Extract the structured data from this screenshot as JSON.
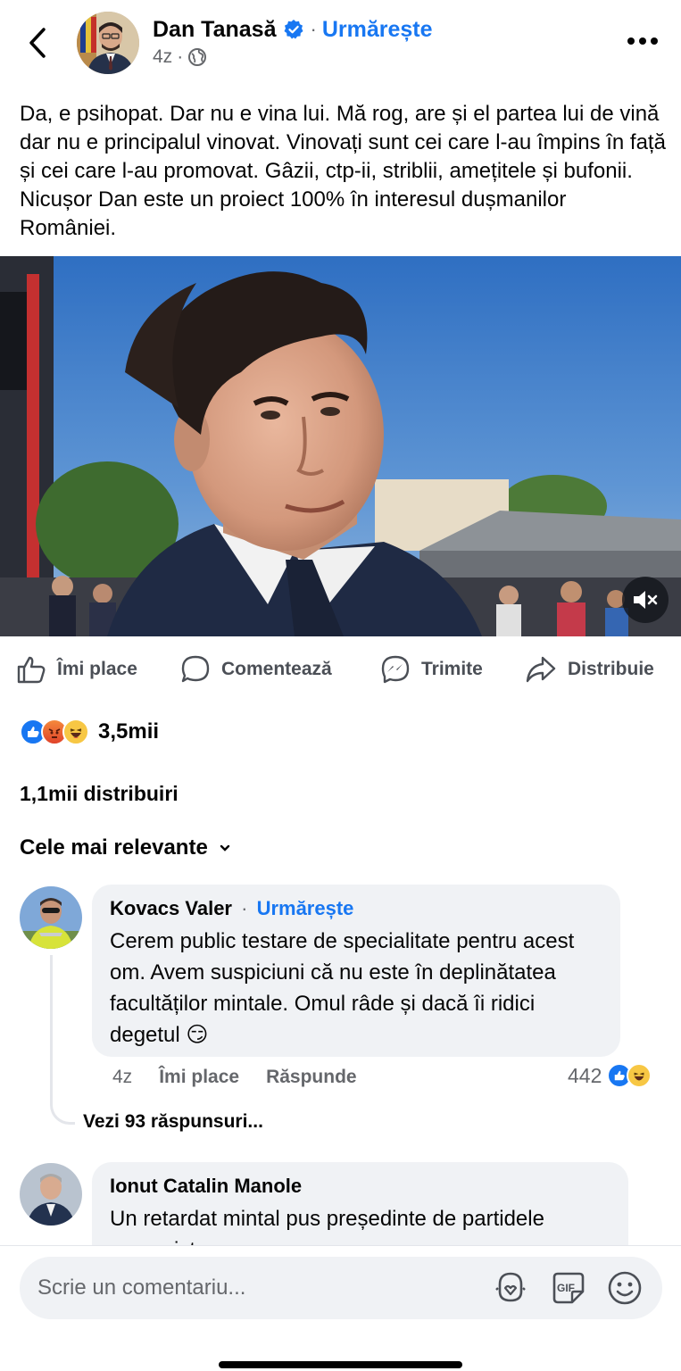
{
  "post": {
    "author": "Dan Tanasă",
    "follow_label": "Urmărește",
    "time": "4z",
    "text": "Da, e psihopat. Dar nu e vina lui. Mă rog, are și el partea lui de vină dar nu e principalul vinovat. Vinovați sunt cei care l-au împins în față și cei care l-au promovat. Gâzii, ctp-ii, striblii, amețitele și bufonii. Nicușor Dan este un proiect 100% în interesul dușmanilor României."
  },
  "actions": {
    "like": "Îmi place",
    "comment": "Comentează",
    "send": "Trimite",
    "share": "Distribuie"
  },
  "stats": {
    "reactions_count": "3,5mii",
    "reaction_icons": [
      "like-icon",
      "angry-icon",
      "haha-icon"
    ],
    "shares": "1,1mii distribuiri"
  },
  "sort_label": "Cele mai relevante",
  "comments": [
    {
      "name": "Kovacs Valer",
      "follow_label": "Urmărește",
      "text": "Cerem public testare de specialitate pentru acest om. Avem suspiciuni că nu este în deplinătatea facultăților mintale. Omul râde și dacă îi ridici degetul 😏",
      "time": "4z",
      "like_label": "Îmi place",
      "reply_label": "Răspunde",
      "reactions_count": "442",
      "view_replies": "Vezi 93 răspunsuri..."
    },
    {
      "name": "Ionut Catalin Manole",
      "text": "Un retardat mintal pus președinte de partidele comuniste"
    }
  ],
  "composer": {
    "placeholder": "Scrie un comentariu..."
  },
  "colors": {
    "accent": "#1877f2",
    "muted": "#65676b",
    "bubble": "#f0f2f5"
  }
}
